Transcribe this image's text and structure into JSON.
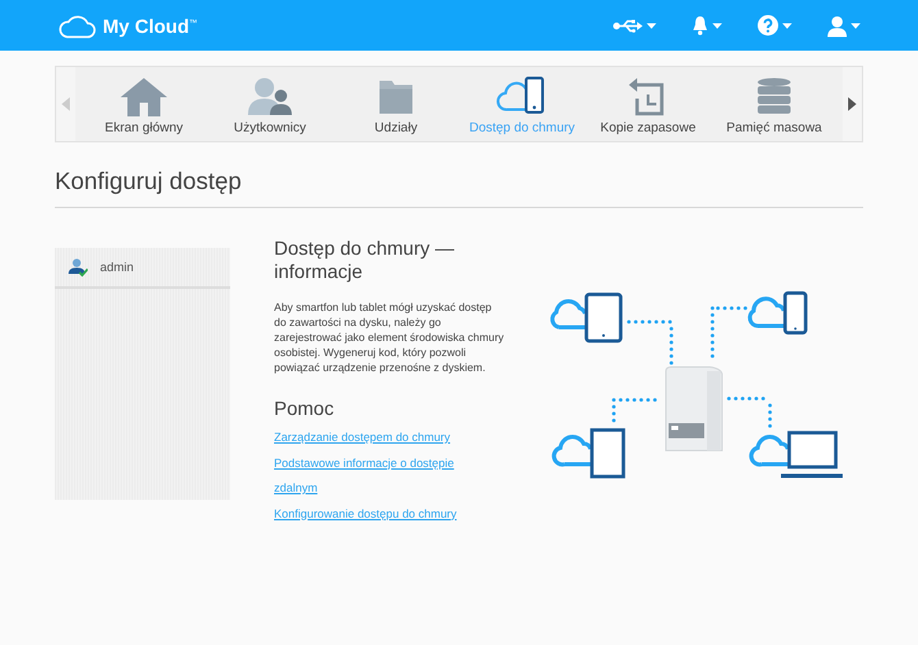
{
  "header": {
    "logo_text": "My Cloud",
    "logo_mark": "™"
  },
  "nav": {
    "tabs": [
      {
        "label": "Ekran główny",
        "kind": "home",
        "selected": false
      },
      {
        "label": "Użytkownicy",
        "kind": "users",
        "selected": false
      },
      {
        "label": "Udziały",
        "kind": "shares",
        "selected": false
      },
      {
        "label": "Dostęp do chmury",
        "kind": "cloud",
        "selected": true
      },
      {
        "label": "Kopie zapasowe",
        "kind": "backup",
        "selected": false
      },
      {
        "label": "Pamięć masowa",
        "kind": "storage",
        "selected": false
      }
    ]
  },
  "page_title": "Konfiguruj dostęp",
  "sidebar": {
    "items": [
      {
        "label": "admin"
      }
    ]
  },
  "info": {
    "title": "Dostęp do chmury — informacje",
    "text": "Aby smartfon lub tablet mógł uzyskać dostęp do zawartości na dysku, należy go zarejestrować jako element środowiska chmury osobistej. Wygeneruj kod, który pozwoli powiązać urządzenie przenośne z dyskiem."
  },
  "help": {
    "title": "Pomoc",
    "links": [
      "Zarządzanie dostępem do chmury",
      "Podstawowe informacje o dostępie zdalnym",
      "Konfigurowanie dostępu do chmury"
    ]
  }
}
